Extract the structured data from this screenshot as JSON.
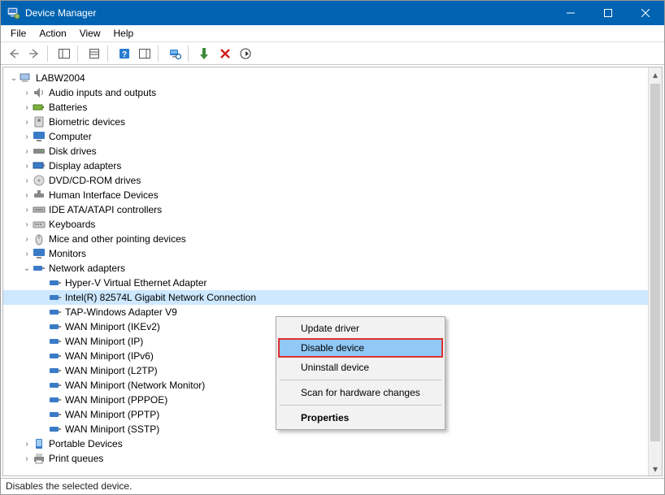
{
  "window": {
    "title": "Device Manager"
  },
  "menu": {
    "file": "File",
    "action": "Action",
    "view": "View",
    "help": "Help"
  },
  "tree": {
    "root": "LABW2004",
    "cat": {
      "audio": "Audio inputs and outputs",
      "batteries": "Batteries",
      "biometric": "Biometric devices",
      "computer": "Computer",
      "disk": "Disk drives",
      "display": "Display adapters",
      "dvd": "DVD/CD-ROM drives",
      "hid": "Human Interface Devices",
      "ide": "IDE ATA/ATAPI controllers",
      "keyboards": "Keyboards",
      "mice": "Mice and other pointing devices",
      "monitors": "Monitors",
      "network": "Network adapters",
      "portable": "Portable Devices",
      "print": "Print queues"
    },
    "net": {
      "hyperv": "Hyper-V Virtual Ethernet Adapter",
      "intel": "Intel(R) 82574L Gigabit Network Connection",
      "tap": "TAP-Windows Adapter V9",
      "ikev2": "WAN Miniport (IKEv2)",
      "ip": "WAN Miniport (IP)",
      "ipv6": "WAN Miniport (IPv6)",
      "l2tp": "WAN Miniport (L2TP)",
      "netmon": "WAN Miniport (Network Monitor)",
      "pppoe": "WAN Miniport (PPPOE)",
      "pptp": "WAN Miniport (PPTP)",
      "sstp": "WAN Miniport (SSTP)"
    }
  },
  "context_menu": {
    "update": "Update driver",
    "disable": "Disable device",
    "uninstall": "Uninstall device",
    "scan": "Scan for hardware changes",
    "properties": "Properties"
  },
  "status": "Disables the selected device."
}
